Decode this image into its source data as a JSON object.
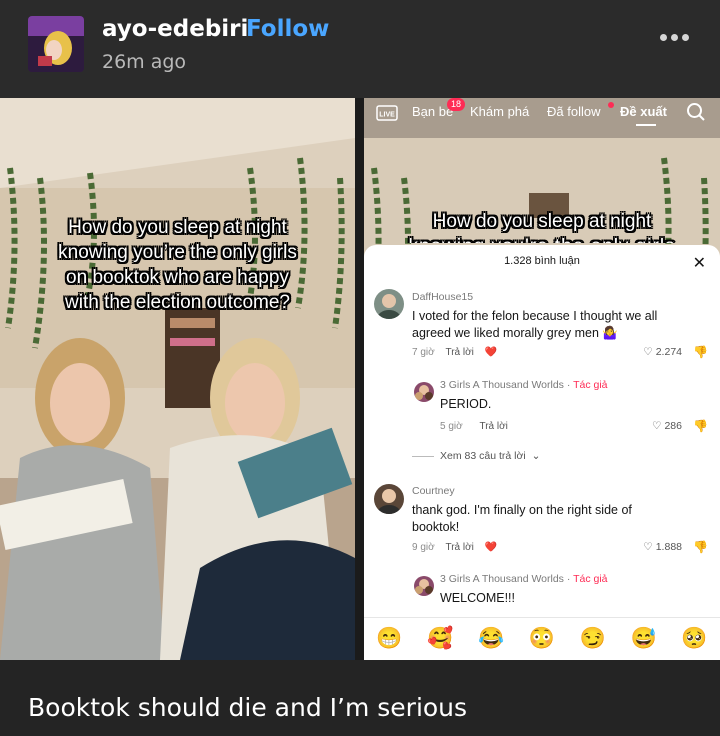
{
  "post": {
    "username": "ayo-edebiri",
    "follow_label": "Follow",
    "time": "26m ago",
    "caption": "Booktok should die and I’m serious"
  },
  "left_image": {
    "overlay_lines": [
      "How do you sleep at night",
      "knowing you’re the only girls",
      "on booktok who are happy",
      "with the election outcome?"
    ]
  },
  "right_image": {
    "live_label": "LIVE",
    "tabs": [
      "Bạn bè",
      "Khám phá",
      "Đã follow",
      "Đề xuất"
    ],
    "badge_count": "18",
    "overlay_line": "How do you sleep at night",
    "comments_panel": {
      "title": "1.328 bình luận",
      "more_replies": "Xem 83 câu trả lời",
      "reply_label": "Trả lời",
      "author_label": "Tác giả",
      "comments": [
        {
          "name": "DaffHouse15",
          "text": "I voted for the felon because I thought we all agreed we liked morally grey men 🤷‍♀️",
          "time": "7 giờ",
          "likes": "2.274"
        },
        {
          "name": "3 Girls A Thousand Worlds",
          "text": "PERIOD.",
          "time": "5 giờ",
          "likes": "286"
        },
        {
          "name": "Courtney",
          "text": "thank god. I'm finally on the right side of booktok!",
          "time": "9 giờ",
          "likes": "1.888"
        },
        {
          "name": "3 Girls A Thousand Worlds",
          "text": "WELCOME!!!"
        }
      ],
      "emojis": [
        "😁",
        "🥰",
        "😂",
        "😳",
        "😏",
        "😅",
        "🥺"
      ]
    }
  },
  "colors": {
    "follow": "#4aa6ff",
    "author": "#fe2c55",
    "header_bg": "#2b2b2b",
    "page_bg": "#242424"
  }
}
